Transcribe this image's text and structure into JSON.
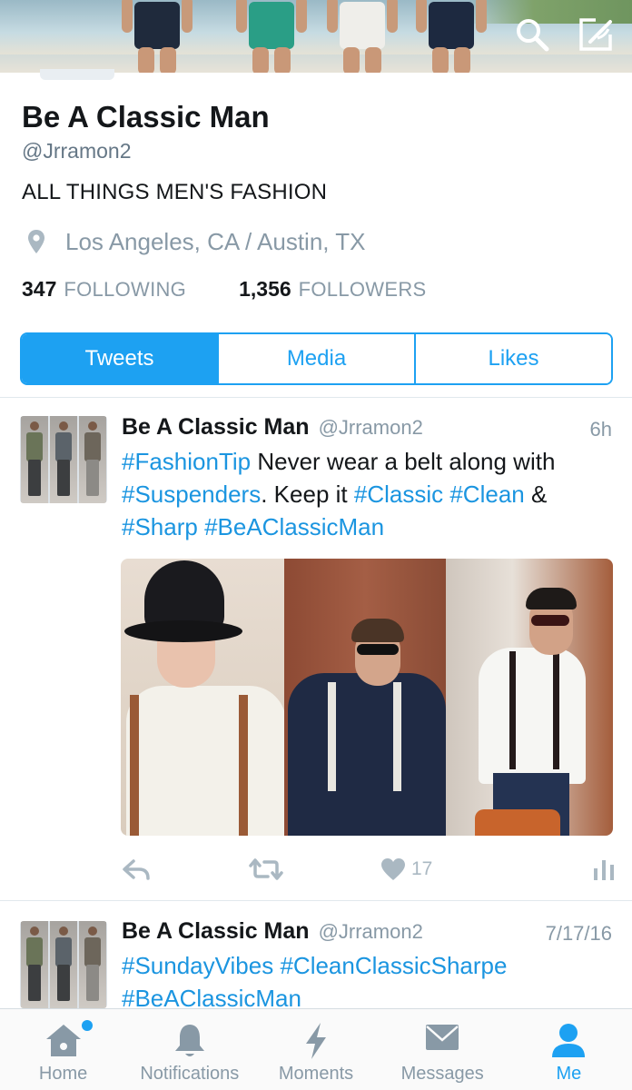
{
  "colors": {
    "accent": "#1da1f2",
    "hashtag": "#1b95e0",
    "muted": "#8899a6",
    "icon": "#aab8c2",
    "text": "#14171a"
  },
  "header": {
    "icons": [
      "search-icon",
      "compose-icon"
    ]
  },
  "profile": {
    "name": "Be A Classic Man",
    "handle": "@Jrramon2",
    "bio": "ALL THINGS MEN'S FASHION",
    "location": "Los Angeles, CA / Austin, TX",
    "following_count": "347",
    "following_label": "FOLLOWING",
    "followers_count": "1,356",
    "followers_label": "FOLLOWERS"
  },
  "tabs": [
    {
      "label": "Tweets",
      "active": true
    },
    {
      "label": "Media",
      "active": false
    },
    {
      "label": "Likes",
      "active": false
    }
  ],
  "tweets": [
    {
      "name": "Be A Classic Man",
      "handle": "@Jrramon2",
      "time": "6h",
      "lines": [
        [
          {
            "t": "#FashionTip",
            "tag": true
          },
          {
            "t": " Never wear a belt along with",
            "tag": false
          }
        ],
        [
          {
            "t": "#Suspenders",
            "tag": true
          },
          {
            "t": ". Keep it ",
            "tag": false
          },
          {
            "t": "#Classic",
            "tag": true
          },
          {
            "t": " ",
            "tag": false
          },
          {
            "t": "#Clean",
            "tag": true
          },
          {
            "t": " &",
            "tag": false
          }
        ],
        [
          {
            "t": "#Sharp",
            "tag": true
          },
          {
            "t": " ",
            "tag": false
          },
          {
            "t": "#BeAClassicMan",
            "tag": true
          }
        ]
      ],
      "like_count": "17"
    },
    {
      "name": "Be A Classic Man",
      "handle": "@Jrramon2",
      "time": "7/17/16",
      "lines": [
        [
          {
            "t": "#SundayVibes",
            "tag": true
          },
          {
            "t": " ",
            "tag": false
          },
          {
            "t": "#CleanClassicSharpe",
            "tag": true
          }
        ],
        [
          {
            "t": "#BeAClassicMan",
            "tag": true
          }
        ]
      ]
    }
  ],
  "tabbar": [
    {
      "label": "Home",
      "icon": "home-icon",
      "active": false
    },
    {
      "label": "Notifications",
      "icon": "bell-icon",
      "active": false
    },
    {
      "label": "Moments",
      "icon": "lightning-icon",
      "active": false
    },
    {
      "label": "Messages",
      "icon": "envelope-icon",
      "active": false
    },
    {
      "label": "Me",
      "icon": "person-icon",
      "active": true
    }
  ]
}
